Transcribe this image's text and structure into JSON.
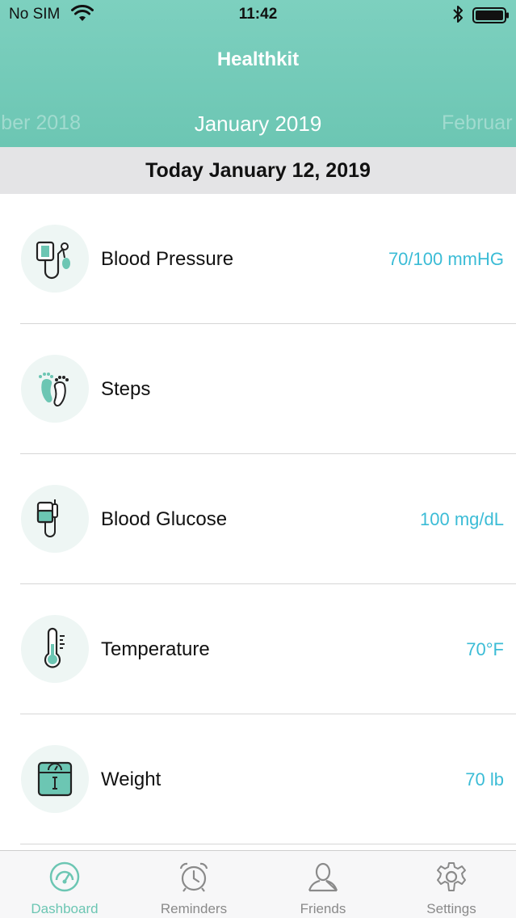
{
  "status_bar": {
    "carrier": "No SIM",
    "time": "11:42"
  },
  "header": {
    "title": "Healthkit",
    "months": {
      "previous": "ber 2018",
      "current": "January 2019",
      "next": "Februar"
    }
  },
  "date_band": "Today January 12, 2019",
  "metrics": [
    {
      "label": "Blood Pressure",
      "value": "70/100 mmHG",
      "icon": "blood-pressure-icon"
    },
    {
      "label": "Steps",
      "value": "",
      "icon": "footprints-icon"
    },
    {
      "label": "Blood Glucose",
      "value": "100 mg/dL",
      "icon": "glucose-meter-icon"
    },
    {
      "label": "Temperature",
      "value": "70°F",
      "icon": "thermometer-icon"
    },
    {
      "label": "Weight",
      "value": "70 lb",
      "icon": "scale-icon"
    }
  ],
  "tabs": [
    {
      "label": "Dashboard",
      "icon": "dashboard-gauge-icon",
      "active": true
    },
    {
      "label": "Reminders",
      "icon": "alarm-clock-icon",
      "active": false
    },
    {
      "label": "Friends",
      "icon": "person-icon",
      "active": false
    },
    {
      "label": "Settings",
      "icon": "gear-icon",
      "active": false
    }
  ],
  "colors": {
    "header": "#6cc6b3",
    "accent_value": "#3bbcd6",
    "icon_fill": "#6cc6b3",
    "icon_circle": "#eef6f4"
  }
}
